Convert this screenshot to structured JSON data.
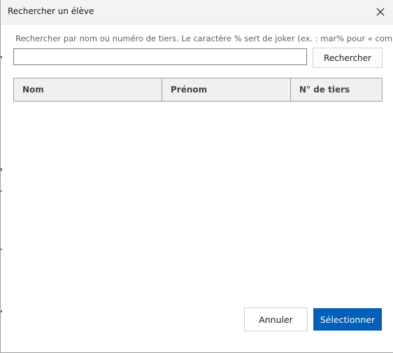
{
  "dialog": {
    "title": "Rechercher un élève",
    "close_icon": "close-icon"
  },
  "search": {
    "hint": "Rechercher par nom ou numéro de tiers. Le caractère % sert de joker (ex. : mar% pour « commence par",
    "value": "",
    "button_label": "Rechercher"
  },
  "table": {
    "columns": [
      {
        "label": "Nom"
      },
      {
        "label": "Prénom"
      },
      {
        "label": "N° de tiers"
      }
    ],
    "rows": []
  },
  "footer": {
    "cancel_label": "Annuler",
    "select_label": "Sélectionner"
  },
  "colors": {
    "accent": "#005fb8",
    "header_bg": "#f0f0f0",
    "titlebar_bg": "#f3f3f3"
  }
}
